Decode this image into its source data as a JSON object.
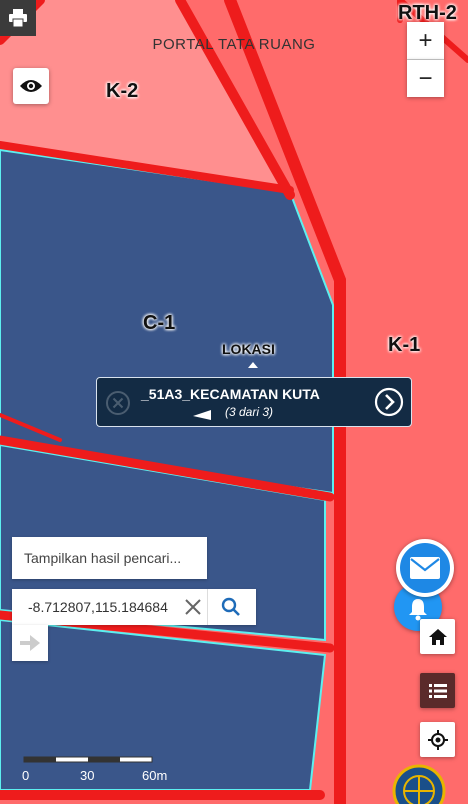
{
  "map": {
    "title": "PORTAL TATA RUANG",
    "zones": {
      "c1": "C-1",
      "k1": "K-1",
      "k2": "K-2",
      "rth2": "RTH-2"
    },
    "marker_label": "LOKASI",
    "colors": {
      "commercial_zone": "#ff6b6b",
      "k2_zone": "#ff8f8f",
      "c1_zone": "#3a568a",
      "roads": "#ee1c1c",
      "parcel_outline": "#5cf0f0"
    }
  },
  "popup": {
    "name": "_51A3_KECAMATAN KUTA",
    "count": "(3 dari 3)",
    "close_icon": "circle-x-icon",
    "next_icon": "circle-chevron-right-icon"
  },
  "search": {
    "results_label": "Tampilkan hasil pencari...",
    "coordinate_value": "-8.712807,115.184684"
  },
  "controls": {
    "zoom_in": "+",
    "zoom_out": "−",
    "icons": [
      "printer-icon",
      "eye-icon",
      "envelope-icon",
      "bell-icon",
      "home-icon",
      "list-icon",
      "locate-icon",
      "arrow-right-icon"
    ]
  },
  "scale_bar": {
    "ticks": [
      "0",
      "30",
      "60m"
    ]
  }
}
